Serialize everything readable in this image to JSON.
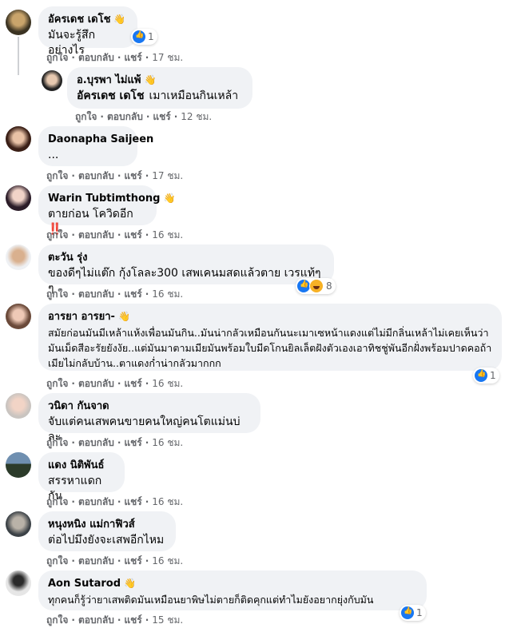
{
  "actions": {
    "like": "ถูกใจ",
    "reply": "ตอบกลับ",
    "share": "แชร์"
  },
  "comments": [
    {
      "author": "อัครเดช เดโช",
      "wave": "👋",
      "text": "มันจะรู้สึกอย่างไร",
      "time": "17 ชม.",
      "react_count": "1",
      "reply": {
        "author": "อ.บุรพา ไม่แพ้",
        "wave": "👋",
        "tag": "อัครเดช เดโช",
        "text": "เมาเหมือนกินเหล้า",
        "time": "12 ชม."
      }
    },
    {
      "author": "Daonapha Saijeen",
      "text": "...",
      "time": "17 ชม."
    },
    {
      "author": "Warin Tubtimthong",
      "wave": "👋",
      "text": "ตายก่อน โควิดอีก",
      "emoji": "‼️",
      "time": "16 ชม."
    },
    {
      "author": "ตะวัน รุ่ง",
      "text": "ของดีๆไม่แต๊ก กุ้งโลละ300 เสพเคนมสดแล้วตาย เวรแท้ๆๆ",
      "time": "16 ชม.",
      "react_count": "8"
    },
    {
      "author": "อารยา อารยา-",
      "wave": "👋",
      "text": "สมัยก่อนมันมีเหล้าแห้งเพื่อนมันกิน..มันน่ากลัวเหมือนกันนะเมาเซหน้าแดงแต่ไม่มีกลิ่นเหล้าไม่เคยเห็นว่ามันเม็ดสีอะรัยยังงัย..แต่มันมาตามเมียมันพร้อมใบมีดโกนยิลเล็ตฝังตัวเองเอาทิชชู่พันอีกฝั่งพร้อมปาดคอถ้าเมียไม่กลับบ้าน..ตาแดงก่ำน่ากลัวมากกก",
      "time": "16 ชม.",
      "react_count": "1"
    },
    {
      "author": "วนิดา กันจาด",
      "text": "จับแต่คนเสพคนขายคนใหญ่คนโตแม่นบ่ละ",
      "time": "16 ชม."
    },
    {
      "author": "แดง นิติพันธ์",
      "text": "สรรหาแดกกัน",
      "time": "16 ชม."
    },
    {
      "author": "หนุงหนิง แม่กาฟิวส์",
      "text": "ต่อไปมึงยังจะเสพอีกไหม",
      "time": "16 ชม."
    },
    {
      "author": "Aon Sutarod",
      "wave": "👋",
      "text": "ทุกคนก็รู้ว่ายาเสพติดมันเหมือนยาพิษไม่ตายก็ติดคุกแต่ทำไมยังอยากยุ่งกับมัน",
      "time": "15 ชม.",
      "react_count": "1"
    }
  ],
  "colors": {
    "bubble": "#f0f2f5",
    "meta": "#65676b",
    "like": "#1877f2"
  }
}
